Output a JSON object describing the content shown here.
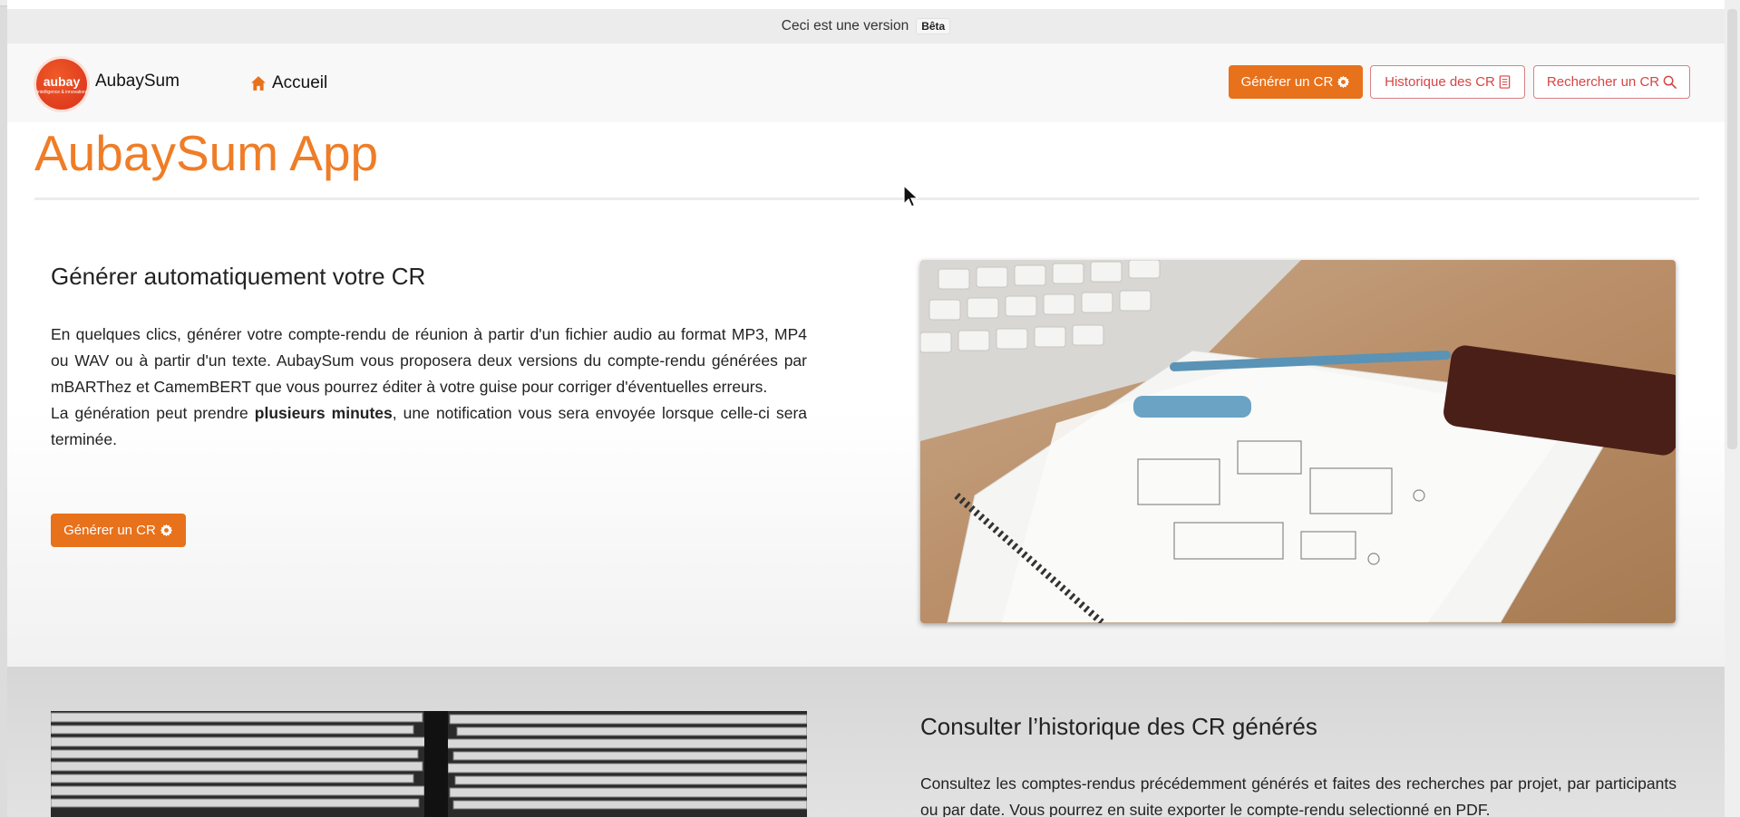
{
  "beta_banner": {
    "text": "Ceci est une version",
    "badge": "Bêta"
  },
  "navbar": {
    "logo_text": "aubay",
    "logo_subtext": "intelligence & innovation",
    "brand": "AubaySum",
    "home": "Accueil",
    "buttons": {
      "generate": "Générer un CR",
      "history": "Historique des CR",
      "search": "Rechercher un CR"
    }
  },
  "page": {
    "title": "AubaySum App"
  },
  "section_generate": {
    "heading": "Générer automatiquement votre CR",
    "paragraph1": "En quelques clics, générer votre compte-rendu de réunion à partir d'un fichier audio au format MP3, MP4 ou WAV ou à partir d'un texte. AubaySum vous proposera deux versions du compte-rendu générées par mBARThez et CamemBERT que vous pourrez éditer à votre guise pour corriger d'éventuelles erreurs.",
    "paragraph2_before": "La génération peut prendre ",
    "paragraph2_bold": "plusieurs minutes",
    "paragraph2_after": ", une notification vous sera envoyée lorsque celle-ci sera terminée.",
    "button": "Générer un CR"
  },
  "section_history": {
    "heading": "Consulter l’historique des CR générés",
    "paragraph": "Consultez les comptes-rendus précédemment générés et faites des recherches par projet, par participants ou par date. Vous pourrez en suite exporter le compte-rendu selectionné en PDF."
  },
  "colors": {
    "accent": "#e8711b",
    "title": "#ef7d27",
    "outline": "#d64545"
  },
  "icons": {
    "home": "home-icon",
    "gear": "gear-icon",
    "document": "document-icon",
    "search": "search-icon"
  }
}
